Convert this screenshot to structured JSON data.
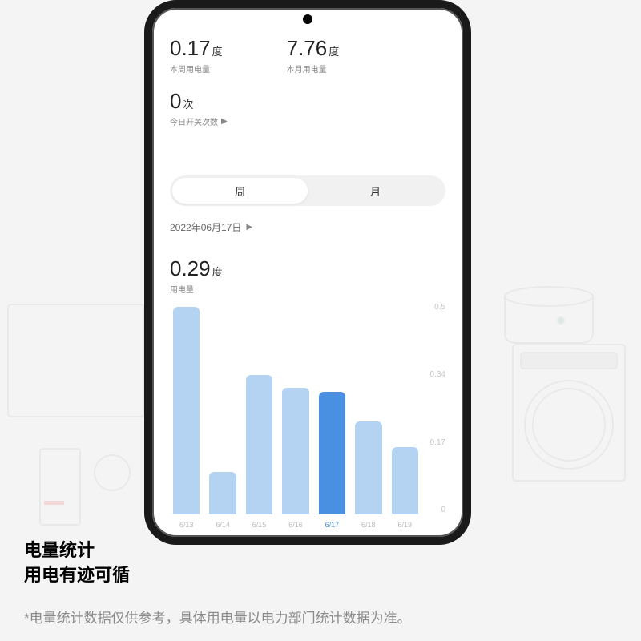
{
  "stats": {
    "weekValue": "0.17",
    "weekUnit": "度",
    "weekLabel": "本周用电量",
    "monthValue": "7.76",
    "monthUnit": "度",
    "monthLabel": "本月用电量",
    "switchValue": "0",
    "switchUnit": "次",
    "switchLabel": "今日开关次数"
  },
  "toggle": {
    "week": "周",
    "month": "月"
  },
  "dateSelector": "2022年06月17日",
  "chartHeader": {
    "value": "0.29",
    "unit": "度",
    "label": "用电量"
  },
  "chart_data": {
    "type": "bar",
    "categories": [
      "6/13",
      "6/14",
      "6/15",
      "6/16",
      "6/17",
      "6/18",
      "6/19"
    ],
    "values": [
      0.49,
      0.1,
      0.33,
      0.3,
      0.29,
      0.22,
      0.16
    ],
    "selected_index": 4,
    "ylabel": "用电量",
    "ylim": [
      0,
      0.5
    ],
    "yticks": [
      0.5,
      0.34,
      0.17,
      0
    ]
  },
  "caption": {
    "line1": "电量统计",
    "line2": "用电有迹可循"
  },
  "footnote": "*电量统计数据仅供参考，具体用电量以电力部门统计数据为准。"
}
